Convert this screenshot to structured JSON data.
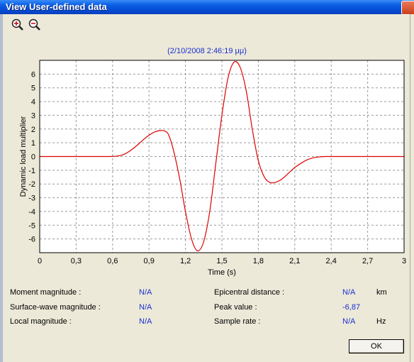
{
  "window": {
    "title": "View User-defined data"
  },
  "toolbar": {
    "zoom_in_icon": "zoom-in-icon",
    "zoom_out_icon": "zoom-out-icon"
  },
  "chart_title": "(2/10/2008 2:46:19 μμ)",
  "chart_data": {
    "type": "line",
    "title": "(2/10/2008 2:46:19 μμ)",
    "xlabel": "Time (s)",
    "ylabel": "Dynamic load multiplier",
    "xlim": [
      0,
      3
    ],
    "ylim": [
      -7,
      7
    ],
    "x_ticks": [
      "0",
      "0,3",
      "0,6",
      "0,9",
      "1,2",
      "1,5",
      "1,8",
      "2,1",
      "2,4",
      "2,7",
      "3"
    ],
    "y_ticks": [
      "6",
      "5",
      "4",
      "3",
      "2",
      "1",
      "0",
      "-1",
      "-2",
      "-3",
      "-4",
      "-5",
      "-6"
    ],
    "grid": true,
    "series": [
      {
        "color": "#e00000",
        "x": [
          0,
          0.3,
          0.55,
          0.6,
          0.65,
          0.7,
          0.75,
          0.8,
          0.85,
          0.9,
          0.95,
          1.0,
          1.03,
          1.06,
          1.1,
          1.15,
          1.2,
          1.25,
          1.3,
          1.35,
          1.4,
          1.45,
          1.5,
          1.55,
          1.6,
          1.65,
          1.7,
          1.75,
          1.8,
          1.85,
          1.9,
          1.95,
          2.0,
          2.05,
          2.1,
          2.15,
          2.2,
          2.25,
          2.3,
          2.35,
          2.4,
          2.6,
          3.0
        ],
        "y": [
          0,
          0,
          0,
          0.01,
          0.05,
          0.18,
          0.45,
          0.8,
          1.2,
          1.55,
          1.8,
          1.9,
          1.85,
          1.6,
          0.5,
          -1.5,
          -4.0,
          -6.0,
          -6.87,
          -6.2,
          -4.0,
          -0.5,
          3.0,
          5.7,
          6.87,
          6.5,
          4.8,
          2.0,
          -0.3,
          -1.5,
          -1.9,
          -1.85,
          -1.6,
          -1.2,
          -0.8,
          -0.5,
          -0.25,
          -0.1,
          -0.03,
          0,
          0,
          0,
          0
        ]
      }
    ]
  },
  "info": {
    "moment_label": "Moment magnitude :",
    "moment_value": "N/A",
    "surface_label": "Surface-wave magnitude :",
    "surface_value": "N/A",
    "local_label": "Local magnitude :",
    "local_value": "N/A",
    "epicentral_label": "Epicentral distance :",
    "epicentral_value": "N/A",
    "epicentral_unit": "km",
    "peak_label": "Peak value :",
    "peak_value": "-6,87",
    "sample_label": "Sample rate :",
    "sample_value": "N/A",
    "sample_unit": "Hz"
  },
  "buttons": {
    "ok": "OK"
  }
}
